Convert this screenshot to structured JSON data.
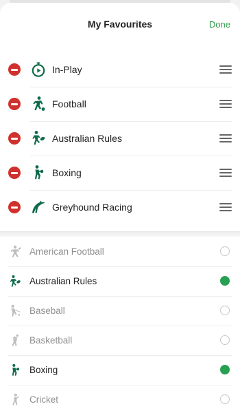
{
  "header": {
    "title": "My Favourites",
    "done_label": "Done"
  },
  "favourites": [
    {
      "label": "In-Play",
      "icon": "stopwatch-icon"
    },
    {
      "label": "Football",
      "icon": "football-player-icon"
    },
    {
      "label": "Australian Rules",
      "icon": "australian-rules-player-icon"
    },
    {
      "label": "Boxing",
      "icon": "boxer-icon"
    },
    {
      "label": "Greyhound Racing",
      "icon": "greyhound-icon"
    }
  ],
  "sports": [
    {
      "label": "American Football",
      "icon": "american-football-player-icon",
      "selected": false
    },
    {
      "label": "Australian Rules",
      "icon": "australian-rules-player-icon",
      "selected": true
    },
    {
      "label": "Baseball",
      "icon": "baseball-player-icon",
      "selected": false
    },
    {
      "label": "Basketball",
      "icon": "basketball-player-icon",
      "selected": false
    },
    {
      "label": "Boxing",
      "icon": "boxer-icon",
      "selected": true
    },
    {
      "label": "Cricket",
      "icon": "cricket-player-icon",
      "selected": false
    }
  ],
  "colors": {
    "accent_green": "#2f9a4d",
    "icon_green": "#0f6b4a",
    "remove_red": "#d0312d",
    "inactive_grey": "#bdbdbd"
  }
}
